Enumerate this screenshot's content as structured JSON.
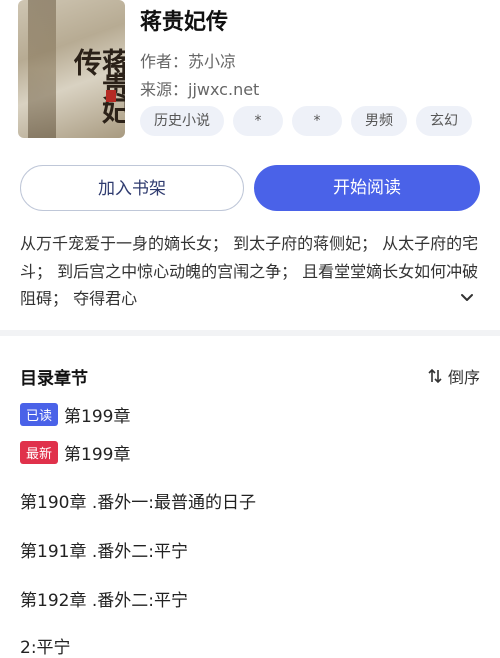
{
  "book": {
    "title": "蒋贵妃传",
    "author_label": "作者：",
    "author": "苏小凉",
    "source_label": "来源：",
    "source": "jjwxc.net",
    "tags": [
      "历史小说",
      "*",
      "*",
      "男频",
      "玄幻"
    ],
    "cover_title": "蒋贵妃传"
  },
  "actions": {
    "add_shelf": "加入书架",
    "start_read": "开始阅读"
  },
  "description": "从万千宠爱于一身的嫡长女；  到太子府的蒋侧妃；  从太子府的宅斗；  到后宫之中惊心动魄的宫闱之争；  且看堂堂嫡长女如何冲破阻碍；  夺得君心",
  "toc": {
    "heading": "目录章节",
    "sort_label": "倒序",
    "read_badge": "已读",
    "read_chapter": "第199章",
    "new_badge": "最新",
    "new_chapter": "第199章",
    "chapters": [
      "第190章 .番外一:最普通的日子",
      "第191章 .番外二:平宁",
      "第192章 .番外二:平宁",
      "2:平宁"
    ]
  },
  "colors": {
    "accent": "#4a62e8",
    "new_badge": "#e0314b",
    "tag_bg": "#eef1f8"
  }
}
